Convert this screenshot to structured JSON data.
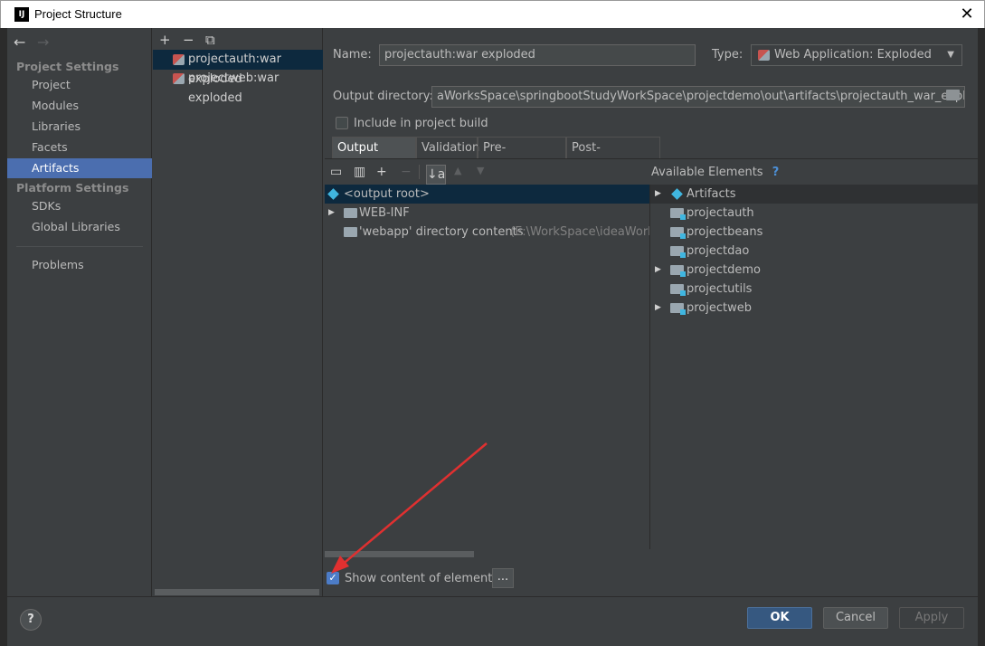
{
  "window": {
    "title": "Project Structure",
    "close": "✕",
    "logo": "IJ"
  },
  "nav": {
    "back": "←",
    "forward": "→"
  },
  "sidebar": {
    "project_settings_label": "Project Settings",
    "project_items": [
      "Project",
      "Modules",
      "Libraries",
      "Facets",
      "Artifacts"
    ],
    "platform_settings_label": "Platform Settings",
    "platform_items": [
      "SDKs",
      "Global Libraries"
    ],
    "problems": "Problems",
    "selected": "Artifacts"
  },
  "artifacts_toolbar": {
    "add": "+",
    "remove": "−",
    "copy": "⧉"
  },
  "artifacts": [
    "projectauth:war exploded",
    "projectweb:war exploded"
  ],
  "form": {
    "name_label": "Name:",
    "name_value": "projectauth:war exploded",
    "type_label": "Type:",
    "type_value": "Web Application: Exploded",
    "output_label": "Output directory:",
    "output_value": "aWorksSpace\\springbootStudyWorkSpace\\projectdemo\\out\\artifacts\\projectauth_war_exploded",
    "include_label": "Include in project build"
  },
  "tabs": [
    "Output Layout",
    "Validation",
    "Pre-processing",
    "Post-processing"
  ],
  "layout_tree": {
    "root": "<output root>",
    "webinf": "WEB-INF",
    "webapp": "'webapp' directory contents",
    "webapp_path": "(E:\\WorkSpace\\ideaWorksS"
  },
  "available": {
    "header": "Available Elements",
    "help": "?",
    "items": [
      "Artifacts",
      "projectauth",
      "projectbeans",
      "projectdao",
      "projectdemo",
      "projectutils",
      "projectweb"
    ]
  },
  "show_content_label": "Show content of elements",
  "dots": "...",
  "footer": {
    "help": "?",
    "ok": "OK",
    "cancel": "Cancel",
    "apply": "Apply"
  },
  "colors": {
    "accent_selection": "#4b6eaf",
    "tree_selection": "#0d293e",
    "arrow": "#e03030"
  }
}
